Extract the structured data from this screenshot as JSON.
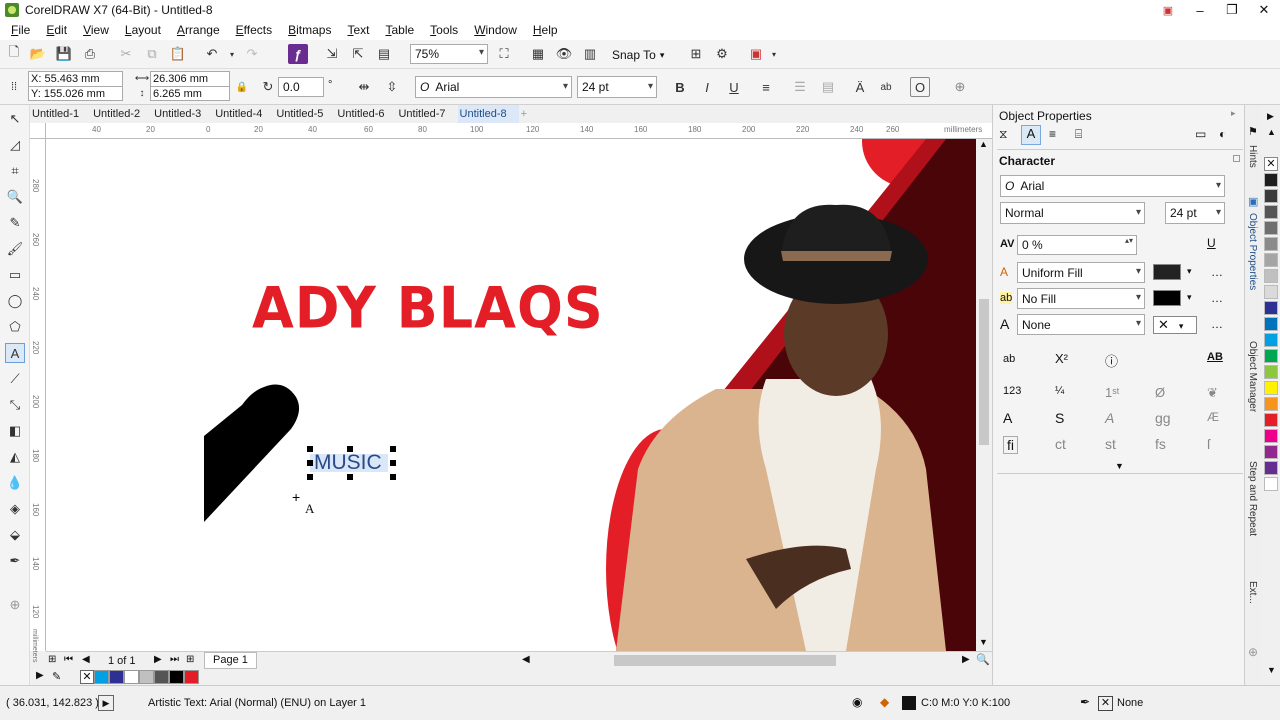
{
  "window": {
    "title": "CorelDRAW X7 (64-Bit) - Untitled-8",
    "minimize": "–",
    "restore": "❐",
    "close": "✕"
  },
  "menu": [
    "File",
    "Edit",
    "View",
    "Layout",
    "Arrange",
    "Effects",
    "Bitmaps",
    "Text",
    "Table",
    "Tools",
    "Window",
    "Help"
  ],
  "toolbar": {
    "zoom": "75%",
    "snap_to": "Snap To"
  },
  "propbar": {
    "x": "X: 55.463 mm",
    "y": "Y: 155.026 mm",
    "w": "26.306 mm",
    "h": "6.265 mm",
    "rotation": "0.0",
    "degree": "°",
    "font": "Arial",
    "size": "24 pt"
  },
  "doc_tabs": [
    "Untitled-1",
    "Untitled-2",
    "Untitled-3",
    "Untitled-4",
    "Untitled-5",
    "Untitled-6",
    "Untitled-7",
    "Untitled-8"
  ],
  "active_tab": "Untitled-8",
  "ruler_h": [
    "40",
    "20",
    "0",
    "20",
    "40",
    "60",
    "80",
    "100",
    "120",
    "140",
    "160",
    "180",
    "200",
    "220",
    "240",
    "260"
  ],
  "ruler_units": "millimeters",
  "ruler_v": [
    "280",
    "260",
    "240",
    "220",
    "200",
    "180",
    "160",
    "140",
    "120",
    "100"
  ],
  "canvas": {
    "headline": "ADY BLAQS",
    "selected_text": "MUSIC",
    "cursor_label": "A",
    "brand_red": "#e31e26"
  },
  "page_nav": {
    "counter": "1 of 1",
    "page_label": "Page 1"
  },
  "palette": [
    "#00a0e3",
    "#2e3192",
    "#ffffff",
    "#c0c0c0",
    "#555555",
    "#000000",
    "#e31e26"
  ],
  "status": {
    "coords": "( 36.031, 142.823 )",
    "info": "Artistic Text: Arial (Normal) (ENU) on Layer 1",
    "fill_color": "C:0 M:0 Y:0 K:100",
    "outline": "None"
  },
  "docker": {
    "title": "Object Properties",
    "section": "Character",
    "font": "Arial",
    "style": "Normal",
    "size": "24 pt",
    "kerning": "0 %",
    "fill_type": "Uniform Fill",
    "bg_fill": "No Fill",
    "outline": "None",
    "fill_swatch": "#222222"
  },
  "docker_tabs": [
    "Hints",
    "Object Properties",
    "Object Manager",
    "Step and Repeat",
    "Ext..."
  ],
  "color_strip": [
    "#1e1e1e",
    "#3a3a3a",
    "#555555",
    "#6e6e6e",
    "#8a8a8a",
    "#a5a5a5",
    "#c0c0c0",
    "#dadada",
    "#2e3192",
    "#0072bc",
    "#00a0e3",
    "#00a651",
    "#8dc63f",
    "#fff200",
    "#f7941d",
    "#e31e26",
    "#ec008c",
    "#92278f",
    "#662d91",
    "#ffffff"
  ]
}
